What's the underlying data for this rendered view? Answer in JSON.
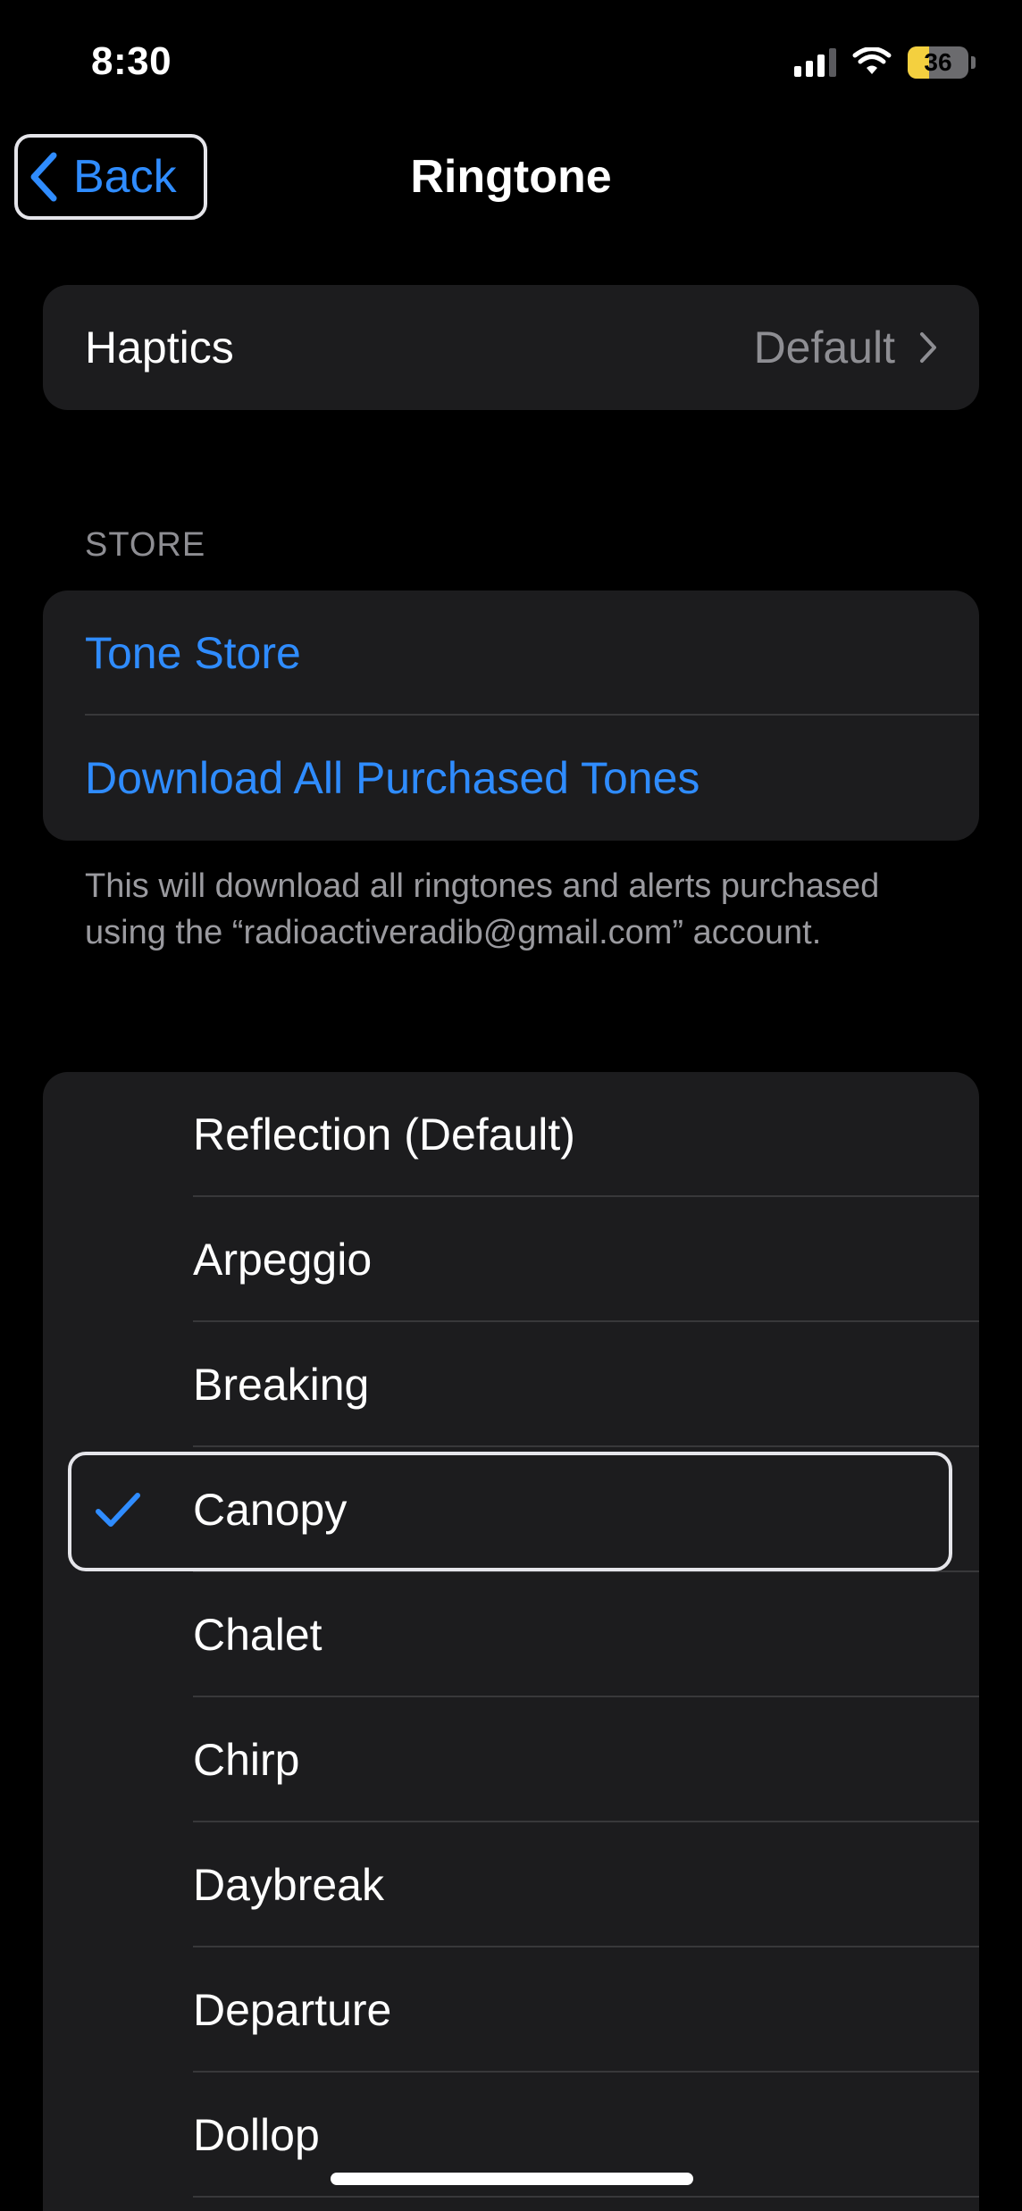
{
  "status_bar": {
    "time": "8:30",
    "battery_level": "36",
    "battery_fraction": 0.36,
    "battery_color": "#f4d03f",
    "signal_bars_active": 3,
    "signal_bars_total": 4,
    "icons": [
      "cellular-signal-icon",
      "wifi-icon",
      "battery-icon"
    ]
  },
  "nav": {
    "back_label": "Back",
    "back_icon": "chevron-left-icon",
    "title": "Ringtone"
  },
  "haptics": {
    "label": "Haptics",
    "value": "Default",
    "icon": "chevron-right-icon"
  },
  "store": {
    "header": "STORE",
    "items": [
      {
        "label": "Tone Store"
      },
      {
        "label": "Download All Purchased Tones"
      }
    ],
    "footer": "This will download all ringtones and alerts purchased using the “radioactiveradib@gmail.com” account."
  },
  "tones": {
    "selected": "Canopy",
    "items": [
      {
        "label": "Reflection (Default)",
        "selected": false
      },
      {
        "label": "Arpeggio",
        "selected": false
      },
      {
        "label": "Breaking",
        "selected": false
      },
      {
        "label": "Canopy",
        "selected": true
      },
      {
        "label": "Chalet",
        "selected": false
      },
      {
        "label": "Chirp",
        "selected": false
      },
      {
        "label": "Daybreak",
        "selected": false
      },
      {
        "label": "Departure",
        "selected": false
      },
      {
        "label": "Dollop",
        "selected": false
      }
    ]
  },
  "colors": {
    "accent": "#2f8cff",
    "background": "#000000",
    "card": "#1c1c1e",
    "secondary_text": "#8e8e93"
  }
}
